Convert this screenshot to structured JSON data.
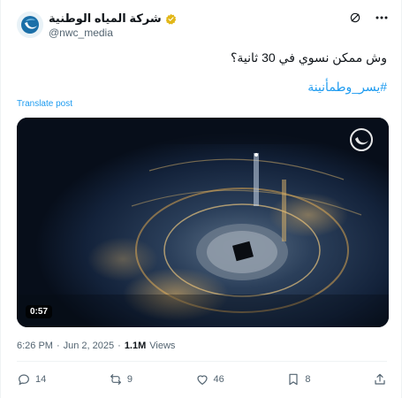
{
  "account": {
    "name": "شركة المياه الوطنية",
    "handle": "@nwc_media",
    "verified": true
  },
  "post": {
    "text": "وش ممكن نسوي في 30 ثانية؟",
    "hashtag": "#يسر_وطمأنينة",
    "translate_label": "Translate post",
    "video_duration": "0:57"
  },
  "meta": {
    "time": "6:26 PM",
    "separator": "·",
    "date": "Jun 2, 2025",
    "views_count": "1.1M",
    "views_label": "Views"
  },
  "actions": {
    "replies": "14",
    "reposts": "9",
    "likes": "46",
    "bookmarks": "8"
  },
  "colors": {
    "accent": "#1d9bf0",
    "text": "#0f1419",
    "muted": "#536471",
    "verified_gold": "#e2b719"
  }
}
